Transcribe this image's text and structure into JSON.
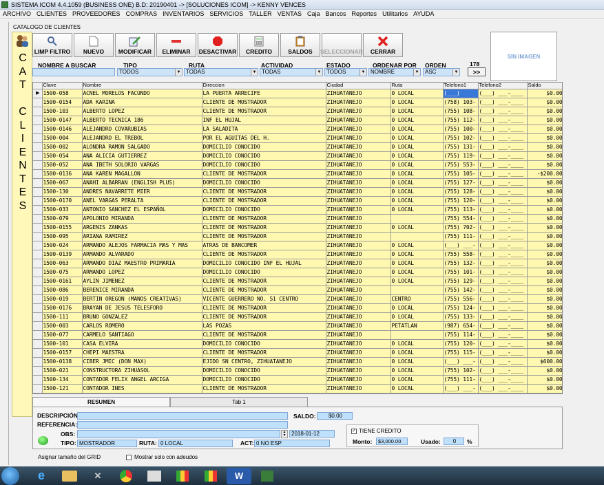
{
  "window": {
    "title": "SISTEMA ICOM 4.4.1059 (BUSINESS ONE)  B.D: 20190401  ->  [SOLUCIONES ICOM]  ->  KENNY VENCES"
  },
  "menu": [
    "ARCHIVO",
    "CLIENTES",
    "PROVEEDORES",
    "COMPRAS",
    "INVENTARIOS",
    "SERVICIOS",
    "TALLER",
    "VENTAS",
    "Caja",
    "Bancos",
    "Reportes",
    "Utilitarios",
    "AYUDA"
  ],
  "catalog_title": "CATALOGO DE CLIENTES",
  "side_letters": "CAT CLIENTES",
  "toolbar": [
    {
      "label": "LIMP FILTRO",
      "icon": "magnifier-icon"
    },
    {
      "label": "NUEVO",
      "icon": "new-document-icon"
    },
    {
      "label": "MODIFICAR",
      "icon": "edit-icon"
    },
    {
      "label": "ELIMINAR",
      "icon": "minus-icon"
    },
    {
      "label": "DESACTIVAR",
      "icon": "stop-icon"
    },
    {
      "label": "CREDITO",
      "icon": "calculator-icon"
    },
    {
      "label": "SALDOS",
      "icon": "clipboard-icon"
    },
    {
      "label": "SELECCIONAR",
      "icon": "select-icon"
    },
    {
      "label": "CERRAR",
      "icon": "close-icon"
    }
  ],
  "no_image": "SIN IMAGEN",
  "filters": {
    "search_label": "NOMBRE A BUSCAR",
    "search_value": "",
    "tipo_label": "TIPO",
    "tipo_value": "TODOS",
    "ruta_label": "RUTA",
    "ruta_value": "TODAS",
    "actividad_label": "ACTIVIDAD",
    "actividad_value": "TODAS",
    "estado_label": "ESTADO",
    "estado_value": "TODOS",
    "ordenar_label": "ORDENAR POR",
    "ordenar_value": "NOMBRE",
    "orden_label": "ORDEN",
    "orden_value": "ASC",
    "count": "178",
    "next_label": ">>"
  },
  "grid": {
    "columns": [
      "Clave",
      "Nombre",
      "Direccion",
      "Ciudad",
      "Ruta",
      "Telefono1",
      "Telefono2",
      "Saldo"
    ],
    "rows": [
      [
        "1500-058",
        "ACNEL MORELOS FACUNDO",
        "LA PUERTA ARRECIFE",
        "ZIHUATANEJO",
        "0 LOCAL",
        "(___)",
        "(___) ___-____",
        "$0.00"
      ],
      [
        "1500-0154",
        "ADA KARINA",
        "CLIENTE DE MOSTRADOR",
        "ZIHUATANEJO",
        "0 LOCAL",
        "(758) 103-",
        "(___) ___-____",
        "$0.00"
      ],
      [
        "1500-103",
        "ALBERTO LOPEZ",
        "CLIENTE DE MOSTRADOR",
        "ZIHUATANEJO",
        "0 LOCAL",
        "(755) 108-",
        "(___) ___-____",
        "$0.00"
      ],
      [
        "1500-0147",
        "ALBERTO TECNICA 186",
        "INF EL HUJAL",
        "ZIHUATANEJO",
        "0 LOCAL",
        "(755) 112-",
        "(___) ___-____",
        "$0.00"
      ],
      [
        "1500-0146",
        "ALEJANDRO COVARUBIAS",
        "LA SALADITA",
        "ZIHUATANEJO",
        "0 LOCAL",
        "(755) 100-",
        "(___) ___-____",
        "$0.00"
      ],
      [
        "1500-004",
        "ALEJANDRO EL TREBOL",
        "POR EL AGUITAS DEL H.",
        "ZIHUATANEJO",
        "0 LOCAL",
        "(755) 102-",
        "(___) ___-____",
        "$0.00"
      ],
      [
        "1500-002",
        "ALONDRA RAMON SALGADO",
        "DOMICILIO CONOCIDO",
        "ZIHUATANEJO",
        "0 LOCAL",
        "(755) 131-",
        "(___) ___-____",
        "$0.00"
      ],
      [
        "1500-054",
        "ANA ALICIA GUTIERREZ",
        "DOMICILIO CONOCIDO",
        "ZIHUATANEJO",
        "0 LOCAL",
        "(755) 119-",
        "(___) ___-____",
        "$0.00"
      ],
      [
        "1500-052",
        "ANA IBETH SOLORIO VARGAS",
        "DOMICILIO CONOCIDO",
        "ZIHUATANEJO",
        "0 LOCAL",
        "(755) 553-",
        "(___) ___-____",
        "$0.00"
      ],
      [
        "1500-0136",
        "ANA KAREN MAGALLON",
        "CLIENTE DE MOSTRADOR",
        "ZIHUATANEJO",
        "0 LOCAL",
        "(755) 105-",
        "(___) ___-____",
        "-$200.00"
      ],
      [
        "1500-067",
        "ANAHI ALBARRAN (ENGLISH PLUS)",
        "DOMICILIO CONOCIDO",
        "ZIHUATANEJO",
        "0 LOCAL",
        "(755) 127-",
        "(___) ___-____",
        "$0.00"
      ],
      [
        "1500-130",
        "ANDRES NAVARRETE MIER",
        "CLIENTE DE MOSTRADOR",
        "ZIHUATANEJO",
        "0 LOCAL",
        "(755) 128-",
        "(___) ___-____",
        "$0.00"
      ],
      [
        "1500-0170",
        "ANEL VARGAS PERALTA",
        "CLIENTE DE MOSTRADOR",
        "ZIHUATANEJO",
        "0 LOCAL",
        "(755) 120-",
        "(___) ___-____",
        "$0.00"
      ],
      [
        "1500-033",
        "ANTONIO SANCHEZ EL ESPAÑOL",
        "DOMICILIO CONOCIDO",
        "ZIHUATANEJO",
        "0 LOCAL",
        "(755) 113-",
        "(___) ___-____",
        "$0.00"
      ],
      [
        "1500-079",
        "APOLONIO MIRANDA",
        "CLIENTE DE MOSTRADOR",
        "ZIHUATANEJO",
        "",
        "(755) 554-",
        "(___) ___-____",
        "$0.00"
      ],
      [
        "1500-0155",
        "ARGENIS ZANKAS",
        "CLIENTE DE MOSTRADOR",
        "ZIHUATANEJO",
        "0 LOCAL",
        "(755) 702-",
        "(___) ___-____",
        "$0.00"
      ],
      [
        "1500-095",
        "ARIANA RAMIREZ",
        "CLIENTE DE MOSTRADOR",
        "ZIHUATANEJO",
        "",
        "(755) 111-",
        "(___) ___-____",
        "$0.00"
      ],
      [
        "1500-024",
        "ARMANDO ALEJOS FARMACIA MAS Y MAS",
        "ATRAS DE BANCOMER",
        "ZIHUATANEJO",
        "0 LOCAL",
        "(___) ___-",
        "(___) ___-____",
        "$0.00"
      ],
      [
        "1500-0139",
        "ARMANDO ALVARADO",
        "CLIENTE DE MOSTRADOR",
        "ZIHUATANEJO",
        "0 LOCAL",
        "(755) 558-",
        "(___) ___-____",
        "$0.00"
      ],
      [
        "1500-063",
        "ARMANDO DIAZ MAESTRO PRIMARIA",
        "DOMICILIO CONOCIDO INF EL HUJAL",
        "ZIHUATANEJO",
        "0 LOCAL",
        "(755) 132-",
        "(___) ___-____",
        "$0.00"
      ],
      [
        "1500-075",
        "ARMANDO LOPEZ",
        "DOMICILIO CONOCIDO",
        "ZIHUATANEJO",
        "0 LOCAL",
        "(755) 101-",
        "(___) ___-____",
        "$0.00"
      ],
      [
        "1500-0161",
        "AYLIN JIMENEZ",
        "CLIENTE DE MOSTRADOR",
        "ZIHUATANEJO",
        "0 LOCAL",
        "(755) 129-",
        "(___) ___-____",
        "$0.00"
      ],
      [
        "1500-086",
        "BERENICE MIRANDA",
        "CLIENTE DE MOSTRADOR",
        "ZIHUATANEJO",
        "",
        "(755) 142-",
        "(___) ___-____",
        "$0.00"
      ],
      [
        "1500-019",
        "BERTIN OREGON (MANOS CREATIVAS)",
        "VICENTE GUERRERO NO. 51 CENTRO",
        "ZIHUATANEJO",
        "CENTRO",
        "(755) 556-",
        "(___) ___-____",
        "$0.00"
      ],
      [
        "1500-0176",
        "BRAYAN DE JESUS TELESFORO",
        "CLIENTE DE MOSTRADOR",
        "ZIHUATANEJO",
        "0 LOCAL",
        "(755) 124-",
        "(___) ___-____",
        "$0.00"
      ],
      [
        "1500-111",
        "BRUNO GONZALEZ",
        "CLIENTE DE MOSTRADOR",
        "ZIHUATANEJO",
        "0 LOCAL",
        "(755) 133-",
        "(___) ___-____",
        "$0.00"
      ],
      [
        "1500-003",
        "CARLOS ROMERO",
        "LAS POZAS",
        "ZIHUATANEJO",
        "PETATLAN",
        "(987) 654-",
        "(___) ___-____",
        "$0.00"
      ],
      [
        "1500-077",
        "CARMELO SANTIAGO",
        "CLIENTE DE MOSTRADOR",
        "ZIHUATANEJO",
        "",
        "(755) 114-",
        "(___) ___-____",
        "$0.00"
      ],
      [
        "1500-101",
        "CASA ELVIRA",
        "DOMICILIO CONOCIDO",
        "ZIHUATANEJO",
        "0 LOCAL",
        "(755) 120-",
        "(___) ___-____",
        "$0.00"
      ],
      [
        "1500-0157",
        "CHEPI MAESTRA",
        "CLIENTE DE MOSTRADOR",
        "ZIHUATANEJO",
        "0 LOCAL",
        "(755) 115-",
        "(___) ___-____",
        "$0.00"
      ],
      [
        "1500-0138",
        "CIBER JMIC (DON MAX)",
        "EJIDO SN CENTRO, ZIHUATANEJO",
        "ZIHUATANEJO",
        "0 LOCAL",
        "(___) ___-",
        "(___) ___-____",
        "$600.00"
      ],
      [
        "1500-021",
        "CONSTRUCTORA ZIHUASOL",
        "DOMICILIO CONOCIDO",
        "ZIHUATANEJO",
        "0 LOCAL",
        "(755) 102-",
        "(___) ___-____",
        "$0.00"
      ],
      [
        "1500-134",
        "CONTADOR FELIX ANGEL ARCIGA",
        "DOMICILIO CONOCIDO",
        "ZIHUATANEJO",
        "0 LOCAL",
        "(755) 111-",
        "(___) ___-____",
        "$0.00"
      ],
      [
        "1500-121",
        "CONTADOR INES",
        "CLIENTE DE MOSTRADOR",
        "ZIHUATANEJO",
        "0 LOCAL",
        "(___) ___-",
        "(___) ___-____",
        "$0.00"
      ]
    ]
  },
  "tabs": [
    "RESUMEN",
    "Tab 1"
  ],
  "summary": {
    "descripcion_label": "DESCRIPCIÓN:",
    "referencia_label": "REFERENCIA:",
    "obs_label": "OBS:",
    "tipo_label": "TIPO:",
    "tipo_value": "MOSTRADOR",
    "ruta_label": "RUTA:",
    "ruta_value": "0 LOCAL",
    "act_label": "ACT:",
    "act_value": "0 NO ESP",
    "date_value": "2018-01-12",
    "saldo_label": "SALDO:",
    "saldo_value": "$0.00",
    "tiene_credito_label": "TIENE CREDITO",
    "monto_label": "Monto:",
    "monto_value": "$3,000.00",
    "usado_label": "Usado:",
    "usado_value": "0",
    "usado_unit": "%"
  },
  "footer": {
    "grid_size_label": "Asignar tamaño del GRID",
    "show_debt_label": "Mostrar solo con adeudos"
  },
  "colors": {
    "row_bg": "#fff8b0",
    "input_bg": "#bfe0fa",
    "selected_cell": "#3a78d8"
  }
}
